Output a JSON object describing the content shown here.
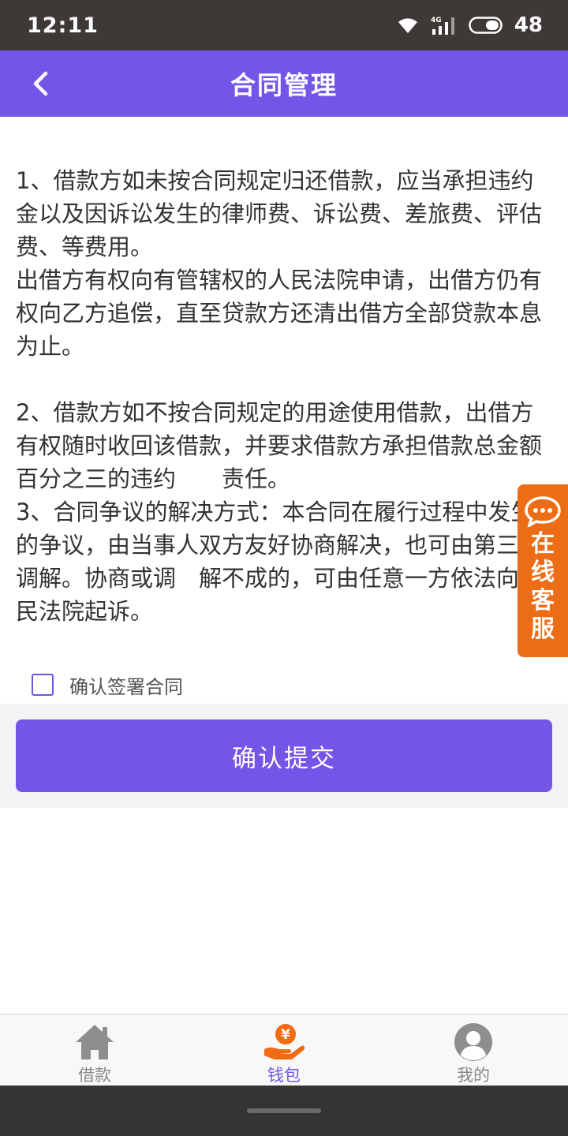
{
  "status_bar": {
    "time": "12:11",
    "network_label": "4G",
    "battery": "48"
  },
  "header": {
    "title": "合同管理"
  },
  "contract": {
    "paragraphs": [
      "1、借款方如未按合同规定归还借款，应当承担违约金以及因诉讼发生的律师费、诉讼费、差旅费、评估费、等费用。\n出借方有权向有管辖权的人民法院申请，出借方仍有权向乙方追偿，直至贷款方还清出借方全部贷款本息为止。",
      "2、借款方如不按合同规定的用途使用借款，出借方有权随时收回该借款，并要求借款方承担借款总金额百分之三的违约　　责任。\n3、合同争议的解决方式：本合同在履行过程中发生的争议，由当事人双方友好协商解决，也可由第三人调解。协商或调　解不成的，可由任意一方依法向人民法院起诉。"
    ]
  },
  "service_float": {
    "label": "在线客服"
  },
  "confirm": {
    "label": "确认签署合同",
    "checked": false
  },
  "submit": {
    "label": "确认提交"
  },
  "tabbar": {
    "items": [
      {
        "label": "借款",
        "icon": "house-icon",
        "active": false
      },
      {
        "label": "钱包",
        "icon": "yuan-wallet-icon",
        "active": true
      },
      {
        "label": "我的",
        "icon": "user-avatar-icon",
        "active": false
      }
    ]
  },
  "colors": {
    "primary": "#7356e8",
    "service_orange": "#ed6d16",
    "wallet_orange": "#f26a12",
    "status_bar_bg": "#3e3836"
  }
}
